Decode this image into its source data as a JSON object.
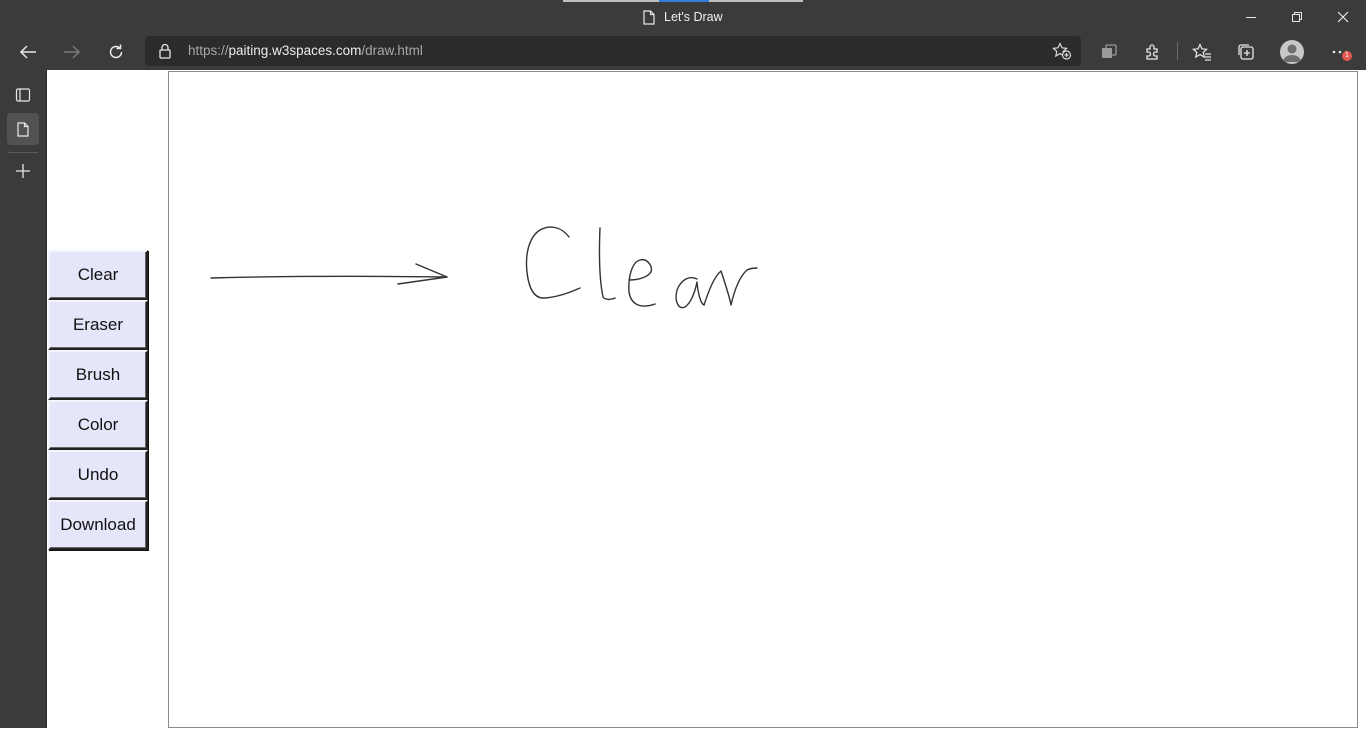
{
  "window": {
    "title": "Let's Draw"
  },
  "addressbar": {
    "protocol": "https://",
    "host": "paiting.w3spaces.com",
    "path": "/draw.html"
  },
  "toolbar": {
    "badge_count": "1"
  },
  "icons": {
    "back": "back-arrow-icon",
    "forward": "forward-arrow-icon",
    "refresh": "refresh-icon",
    "lock": "lock-icon",
    "add_favorite": "add-favorite-icon",
    "collections": "collections-icon",
    "extensions": "extensions-icon",
    "favorites": "favorites-icon",
    "tab_actions": "tab-actions-icon",
    "profile": "profile-icon",
    "more": "more-icon"
  },
  "tools": [
    {
      "label": "Clear"
    },
    {
      "label": "Eraser"
    },
    {
      "label": "Brush"
    },
    {
      "label": "Color"
    },
    {
      "label": "Undo"
    },
    {
      "label": "Download"
    }
  ],
  "colors": {
    "chrome": "#3b3b3b",
    "button_bg": "#e6e6fa",
    "stroke": "#333333"
  }
}
